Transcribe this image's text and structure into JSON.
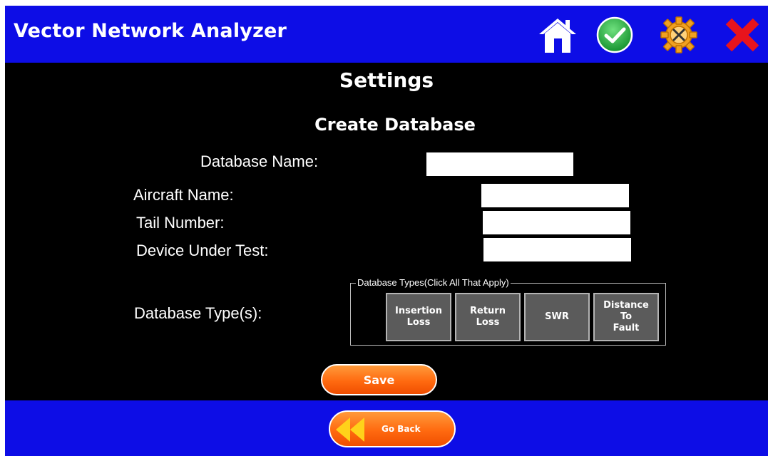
{
  "app": {
    "title": "Vector Network Analyzer",
    "colors": {
      "bar": "#0d0de6",
      "background": "#000000",
      "accent_orange": "#ff6a10",
      "check_green": "#2bb34a",
      "close_red": "#e8141c"
    }
  },
  "toolbar": {
    "icons": [
      "home-icon",
      "check-icon",
      "settings-gear-icon",
      "close-icon"
    ]
  },
  "page": {
    "title": "Settings",
    "section_title": "Create Database"
  },
  "form": {
    "database_name": {
      "label": "Database Name:",
      "value": ""
    },
    "aircraft_name": {
      "label": "Aircraft Name:",
      "value": ""
    },
    "tail_number": {
      "label": "Tail Number:",
      "value": ""
    },
    "device_under_test": {
      "label": "Device Under Test:",
      "value": ""
    },
    "database_types": {
      "label": "Database Type(s):",
      "group_title": "Database Types(Click All That Apply)",
      "options": [
        {
          "label": "Insertion\nLoss"
        },
        {
          "label": "Return\nLoss"
        },
        {
          "label": "SWR"
        },
        {
          "label": "Distance\nTo\nFault"
        }
      ]
    }
  },
  "actions": {
    "save_label": "Save",
    "back_label": "Go Back"
  }
}
